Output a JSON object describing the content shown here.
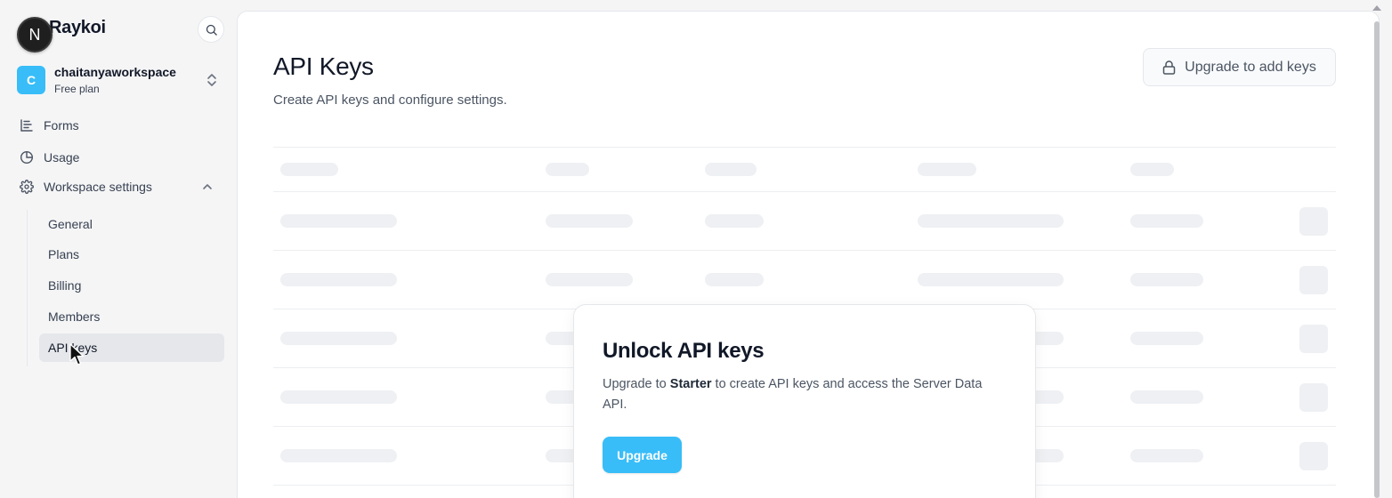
{
  "brand": {
    "mark": "N",
    "name": "Raykoi"
  },
  "workspace": {
    "initial": "C",
    "name": "chaitanyaworkspace",
    "plan": "Free plan"
  },
  "nav": {
    "forms": "Forms",
    "usage": "Usage",
    "workspace_settings": "Workspace settings",
    "sub_items": [
      "General",
      "Plans",
      "Billing",
      "Members",
      "API keys"
    ],
    "active": "API keys"
  },
  "page": {
    "title": "API Keys",
    "subtitle": "Create API keys and configure settings.",
    "upgrade_button": "Upgrade to add keys"
  },
  "modal": {
    "title": "Unlock API keys",
    "text_before": "Upgrade to ",
    "text_strong": "Starter",
    "text_after": " to create API keys and access the Server Data API.",
    "button": "Upgrade"
  },
  "colors": {
    "accent": "#38bdf8",
    "skeleton": "#eef0f3"
  },
  "icons": [
    "search-icon",
    "chevron-updown-icon",
    "forms-icon",
    "usage-icon",
    "gear-icon",
    "chevron-up-icon",
    "lock-icon",
    "cursor-icon"
  ]
}
